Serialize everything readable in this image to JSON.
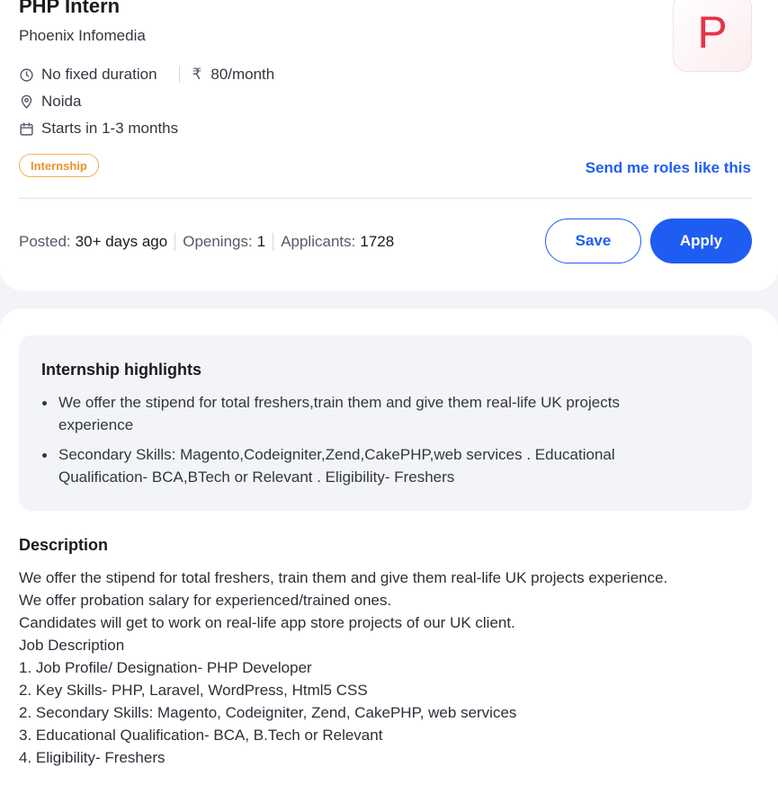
{
  "job": {
    "title": "PHP Intern",
    "company": "Phoenix Infomedia",
    "logo_letter": "P",
    "duration": "No fixed duration",
    "stipend": "80/month",
    "location": "Noida",
    "start": "Starts in 1-3 months",
    "tag": "Internship",
    "send_link": "Send me roles like this"
  },
  "stats": {
    "posted_label": "Posted:",
    "posted_value": "30+ days ago",
    "openings_label": "Openings:",
    "openings_value": "1",
    "applicants_label": "Applicants:",
    "applicants_value": "1728"
  },
  "actions": {
    "save_label": "Save",
    "apply_label": "Apply"
  },
  "highlights": {
    "title": "Internship highlights",
    "items": [
      "We offer the stipend for total freshers,train them and give them real-life UK projects experience",
      "Secondary Skills: Magento,Codeigniter,Zend,CakePHP,web services . Educational Qualification- BCA,BTech or Relevant . Eligibility- Freshers"
    ]
  },
  "description": {
    "title": "Description",
    "lines": [
      "We offer the stipend for total freshers, train them and give them real-life UK projects experience.",
      "We offer probation salary for experienced/trained ones.",
      "Candidates will get to work on real-life app store projects of our UK client.",
      "Job Description",
      "1. Job Profile/ Designation- PHP Developer",
      "2. Key Skills- PHP, Laravel, WordPress, Html5 CSS",
      "2. Secondary Skills: Magento, Codeigniter, Zend, CakePHP, web services",
      "3. Educational Qualification- BCA, B.Tech or Relevant",
      "4. Eligibility- Freshers"
    ]
  },
  "icons": {
    "duration": "clock-icon",
    "stipend": "rupee-icon",
    "location": "map-pin-icon",
    "start": "calendar-icon"
  },
  "colors": {
    "accent": "#1f5df2",
    "tag": "#e9932a",
    "logo": "#e63445"
  }
}
